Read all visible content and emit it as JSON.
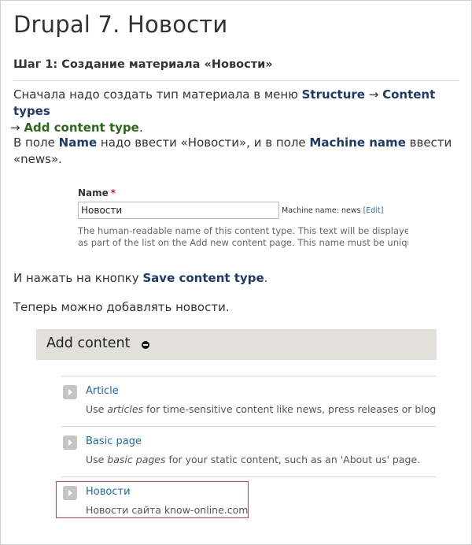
{
  "title": "Drupal 7. Новости",
  "step_heading": "Шаг 1: Создание материала «Новости»",
  "para1": {
    "prefix": "Сначала надо создать тип материала в меню ",
    "structure": "Structure",
    "arrow1": " → ",
    "content_types": "Content types",
    "arrow2": " → ",
    "add_content_type": "Add content type",
    "suffix": "."
  },
  "para2": {
    "prefix": "В поле ",
    "name": "Name",
    "middle": " надо ввести «Новости», и в поле ",
    "machine_name": "Machine name",
    "suffix": " ввести «news»."
  },
  "form": {
    "label": "Name",
    "required_mark": "*",
    "value": "Новости",
    "machine_prefix": "Machine name: news ",
    "edit_open": "[",
    "edit_link": "Edit",
    "edit_close": "]",
    "description": "The human-readable name of this content type. This text will be displayed as part of the list on the Add new content page. This name must be unique."
  },
  "para3": {
    "prefix": "И нажать на кнопку ",
    "button": "Save content type",
    "suffix": "."
  },
  "para4": "Теперь можно добавлять новости.",
  "add_content": {
    "title": "Add content",
    "items": [
      {
        "label": "Article",
        "desc_prefix": "Use ",
        "desc_em": "articles",
        "desc_suffix": " for time-sensitive content like news, press releases or blog posts."
      },
      {
        "label": "Basic page",
        "desc_prefix": "Use ",
        "desc_em": "basic pages",
        "desc_suffix": " for your static content, such as an 'About us' page."
      },
      {
        "label": "Новости",
        "desc_prefix": "Новости сайта know-online.com",
        "desc_em": "",
        "desc_suffix": ""
      }
    ]
  },
  "colors": {
    "link": "#1a6aa9",
    "keyword": "#1d3a6b",
    "keyword_green": "#2a6b1a",
    "highlight": "#e23a3a",
    "panel_bg": "#e1e0db"
  }
}
